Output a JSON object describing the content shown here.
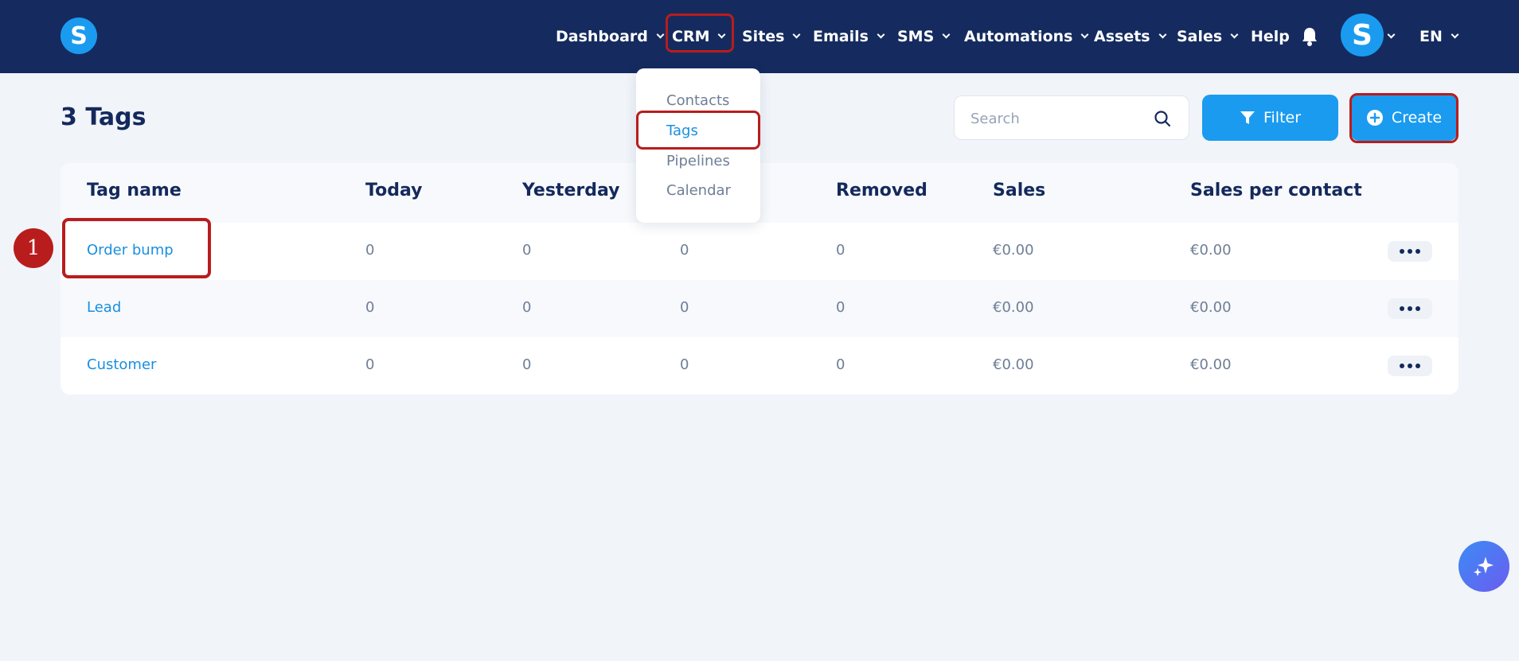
{
  "app": {
    "logo_letter": "S",
    "avatar_letter": "S"
  },
  "nav": {
    "items": [
      {
        "label": "Dashboard"
      },
      {
        "label": "CRM"
      },
      {
        "label": "Sites"
      },
      {
        "label": "Emails"
      },
      {
        "label": "SMS"
      },
      {
        "label": "Automations"
      },
      {
        "label": "Assets"
      },
      {
        "label": "Sales"
      },
      {
        "label": "Help"
      }
    ],
    "language": "EN"
  },
  "crm_menu": {
    "items": [
      {
        "label": "Contacts"
      },
      {
        "label": "Tags",
        "active": true
      },
      {
        "label": "Pipelines"
      },
      {
        "label": "Calendar"
      }
    ]
  },
  "page": {
    "title": "3 Tags",
    "search_placeholder": "Search",
    "filter_label": "Filter",
    "create_label": "Create"
  },
  "table": {
    "columns": [
      "Tag name",
      "Today",
      "Yesterday",
      "",
      "Removed",
      "Sales",
      "Sales per contact"
    ],
    "rows": [
      {
        "name": "Order bump",
        "today": "0",
        "yesterday": "0",
        "col4": "0",
        "removed": "0",
        "sales": "€0.00",
        "per_contact": "€0.00"
      },
      {
        "name": "Lead",
        "today": "0",
        "yesterday": "0",
        "col4": "0",
        "removed": "0",
        "sales": "€0.00",
        "per_contact": "€0.00"
      },
      {
        "name": "Customer",
        "today": "0",
        "yesterday": "0",
        "col4": "0",
        "removed": "0",
        "sales": "€0.00",
        "per_contact": "€0.00"
      }
    ]
  },
  "annotation": {
    "step_number": "1"
  },
  "colors": {
    "navbar": "#152b5f",
    "accent": "#1a9bf0",
    "highlight": "#b91c1c"
  }
}
